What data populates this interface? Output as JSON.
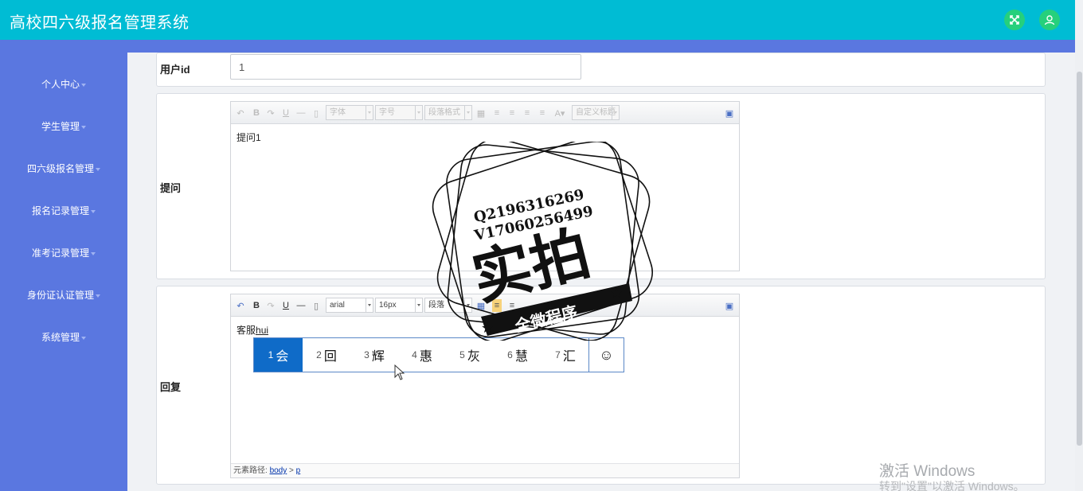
{
  "app": {
    "title": "高校四六级报名管理系统",
    "fullscreen_icon": "expand-arrows-icon",
    "user_icon": "user-icon"
  },
  "sidebar": {
    "items": [
      {
        "label": "个人中心"
      },
      {
        "label": "学生管理"
      },
      {
        "label": "四六级报名管理"
      },
      {
        "label": "报名记录管理"
      },
      {
        "label": "准考记录管理"
      },
      {
        "label": "身份证认证管理"
      },
      {
        "label": "系统管理"
      }
    ]
  },
  "form": {
    "user_id": {
      "label": "用户id",
      "value": "1"
    },
    "question": {
      "label": "提问",
      "content": "提问1",
      "toolbar": {
        "font_family": "字体",
        "font_size": "字号",
        "paragraph": "段落格式",
        "custom_heading": "自定义标题"
      }
    },
    "reply": {
      "label": "回复",
      "content_prefix": "客服",
      "composition": "hui",
      "toolbar": {
        "font_family": "arial",
        "font_size": "16px",
        "paragraph": "段落"
      },
      "element_path_label": "元素路径:",
      "element_path_body": "body",
      "element_path_sep": ">",
      "element_path_p": "p"
    }
  },
  "ime": {
    "candidates": [
      {
        "num": "1",
        "text": "会"
      },
      {
        "num": "2",
        "text": "回"
      },
      {
        "num": "3",
        "text": "辉"
      },
      {
        "num": "4",
        "text": "惠"
      },
      {
        "num": "5",
        "text": "灰"
      },
      {
        "num": "6",
        "text": "慧"
      },
      {
        "num": "7",
        "text": "汇"
      }
    ],
    "selected_index": 0,
    "emoji_icon": "smiley-icon"
  },
  "watermark": {
    "line1": "Q2196316269",
    "line2": "V17060256499",
    "main": "实拍",
    "sub": "全微程序"
  },
  "windows_activation": {
    "line1": "激活 Windows",
    "line2": "转到\"设置\"以激活 Windows。"
  },
  "colors": {
    "header": "#00bcd4",
    "sidebar": "#5a77e0",
    "round_button": "#26d07c",
    "ime_selected": "#0f6bc8"
  }
}
